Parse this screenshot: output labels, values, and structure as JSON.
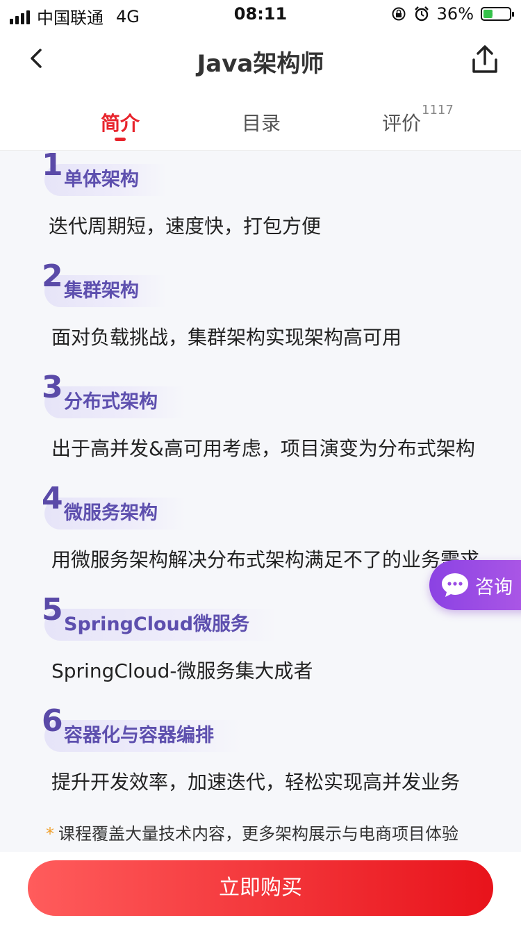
{
  "status_bar": {
    "carrier": "中国联通",
    "network": "4G",
    "time": "08:11",
    "battery": "36%",
    "battery_level": 0.36,
    "icons": [
      "signal-icon",
      "lock-rotation-icon",
      "alarm-icon",
      "battery-icon"
    ]
  },
  "header": {
    "title": "Java架构师",
    "back_icon": "chevron-left-icon",
    "share_icon": "share-icon"
  },
  "tabs": [
    {
      "label": "简介",
      "active": true
    },
    {
      "label": "目录",
      "active": false
    },
    {
      "label": "评价",
      "count": "1117",
      "active": false
    }
  ],
  "sections": [
    {
      "number": "1",
      "title": "单体架构",
      "desc": "迭代周期短，速度快，打包方便"
    },
    {
      "number": "2",
      "title": "集群架构",
      "desc": "面对负载挑战，集群架构实现架构高可用"
    },
    {
      "number": "3",
      "title": "分布式架构",
      "desc": "出于高并发&高可用考虑，项目演变为分布式架构"
    },
    {
      "number": "4",
      "title": "微服务架构",
      "desc": "用微服务架构解决分布式架构满足不了的业务需求"
    },
    {
      "number": "5",
      "title": "SpringCloud微服务",
      "desc": "SpringCloud-微服务集大成者"
    },
    {
      "number": "6",
      "title": "容器化与容器编排",
      "desc": "提升开发效率，加速迭代，轻松实现高并发业务"
    }
  ],
  "note": {
    "star": "*",
    "text": "课程覆盖大量技术内容，更多架构展示与电商项目体验"
  },
  "consult": {
    "label": "咨询",
    "icon": "chat-bubble-icon"
  },
  "buy_button": {
    "label": "立即购买"
  },
  "colors": {
    "accent": "#e8242c",
    "section_title": "#5d4fae",
    "consult_bg": "#9a4be4",
    "buy_gradient_start": "#ff5c5c",
    "buy_gradient_end": "#e8131b"
  }
}
